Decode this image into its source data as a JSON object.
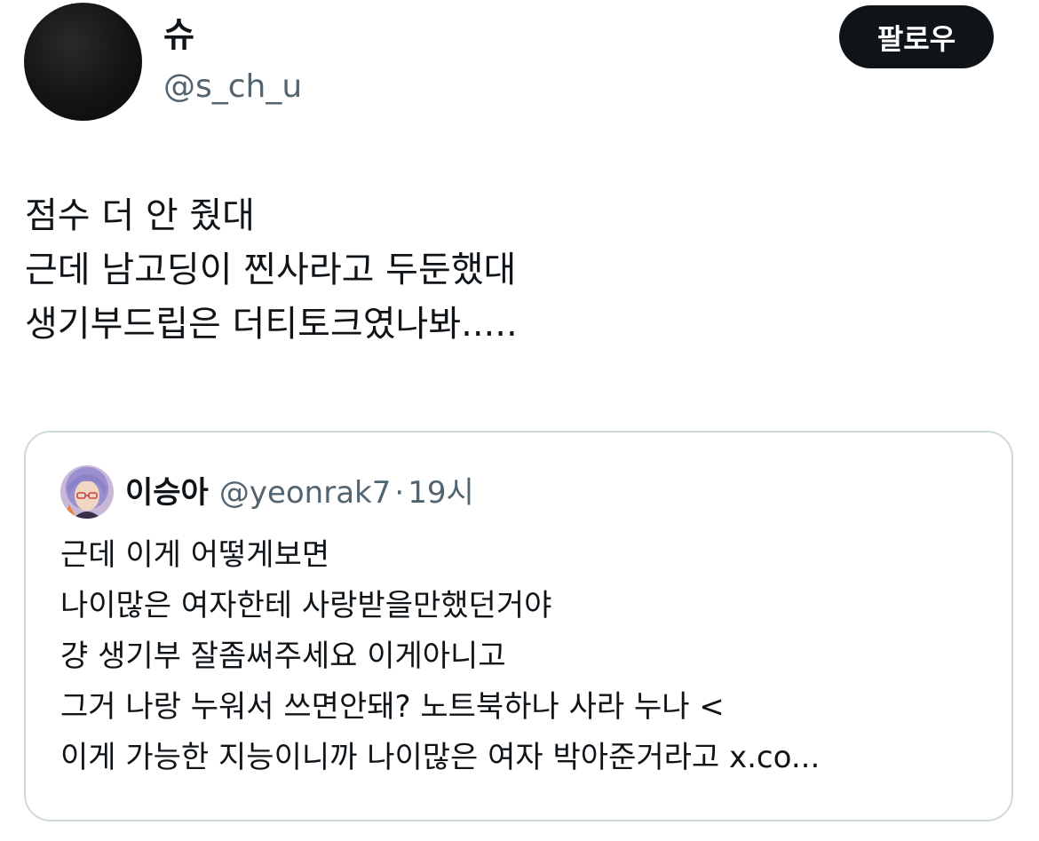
{
  "author": {
    "display_name": "슈",
    "handle": "@s_ch_u",
    "follow_label": "팔로우"
  },
  "tweet": {
    "lines": [
      "점수 더 안 줬대",
      "근데 남고딩이 찐사라고 두둔했대",
      "생기부드립은 더티토크였나봐....."
    ]
  },
  "quoted_tweet": {
    "display_name": "이승아",
    "handle": "@yeonrak7",
    "separator": "·",
    "time": "19시",
    "lines": [
      "근데 이게 어떻게보면",
      "나이많은 여자한테 사랑받을만했던거야",
      "걍 생기부 잘좀써주세요 이게아니고",
      "그거 나랑 누워서 쓰면안돼? 노트북하나 사라 누나 <",
      "이게 가능한 지능이니까 나이많은 여자 박아준거라고 x.co..."
    ]
  },
  "colors": {
    "text_primary": "#0f1419",
    "text_secondary": "#536471",
    "card_border": "#cfd9de",
    "follow_bg": "#0f1419"
  }
}
